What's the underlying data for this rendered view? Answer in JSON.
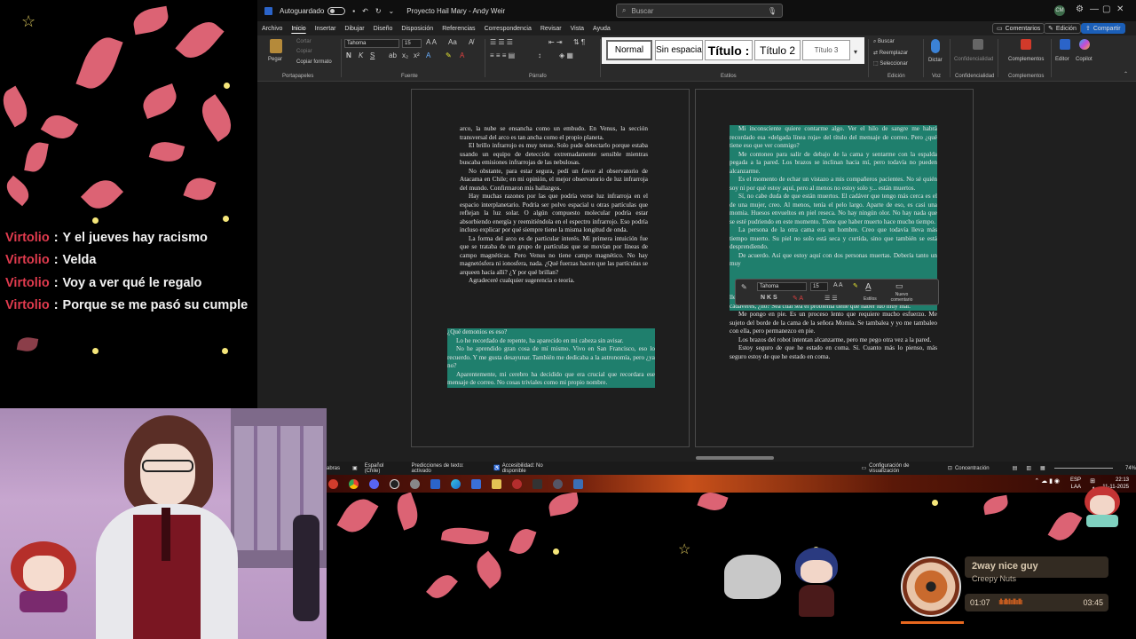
{
  "chat": {
    "messages": [
      {
        "user": "Virtolio",
        "text": "Y el jueves hay racismo"
      },
      {
        "user": "Virtolio",
        "text": "Velda"
      },
      {
        "user": "Virtolio",
        "text": "Voy a ver qué le regalo"
      },
      {
        "user": "Virtolio",
        "text": "Porque se me pasó su cumple"
      }
    ]
  },
  "word": {
    "autosave_label": "Autoguardado",
    "doc_title": "Proyecto Hail Mary - Andy Weir",
    "search_placeholder": "Buscar",
    "user_initials": "CM",
    "menu": [
      "Archivo",
      "Inicio",
      "Insertar",
      "Dibujar",
      "Diseño",
      "Disposición",
      "Referencias",
      "Correspondencia",
      "Revisar",
      "Vista",
      "Ayuda"
    ],
    "comments_label": "Comentarios",
    "edit_label": "Edición",
    "share_label": "Compartir",
    "ribbon": {
      "paste": "Pegar",
      "cut": "Cortar",
      "copy": "Copiar",
      "format_painter": "Copiar formato",
      "clipboard_group": "Portapapeles",
      "font_name": "Tahoma",
      "font_size": "15",
      "font_group": "Fuente",
      "paragraph_group": "Párrafo",
      "styles": [
        "Normal",
        "Sin espacia",
        "Título :",
        "Título 2",
        "Título 3"
      ],
      "styles_group": "Estilos",
      "find": "Buscar",
      "replace": "Reemplazar",
      "select": "Seleccionar",
      "editing_group": "Edición",
      "dictate": "Dictar",
      "voice_group": "Voz",
      "sensitivity": "Confidencialidad",
      "sensitivity_group": "Confidencialidad",
      "addins": "Complementos",
      "addins_group": "Complementos",
      "editor": "Editor",
      "copilot": "Copilot"
    },
    "page_left": {
      "paragraphs": [
        "arco, la nube se ensancha como un embudo. En Venus, la sección transversal del arco es tan ancha como el propio planeta.",
        "El brillo infrarrojo es muy tenue. Solo pude detectarlo porque estaba usando un equipo de detección extremadamente sensible mientras buscaba emisiones infrarrojas de las nebulosas.",
        "No obstante, para estar segura, pedí un favor al observatorio de Atacama en Chile; en mi opinión, el mejor observatorio de luz infrarroja del mundo. Confirmaron mis hallazgos.",
        "Hay muchas razones por las que podría verse luz infrarroja en el espacio interplanetario. Podría ser polvo espacial u otras partículas que reflejan la luz solar. O algún compuesto molecular podría estar absorbiendo energía y reemitiéndola en el espectro infrarrojo. Eso podría incluso explicar por qué siempre tiene la misma longitud de onda.",
        "La forma del arco es de particular interés. Mi primera intuición fue que se trataba de un grupo de partículas que se movían por líneas de campo magnéticas. Pero Venus no tiene campo magnético. No hay magnetósfera ni ionosfera, nada. ¿Qué fuerzas hacen que las partículas se arqueen hacia allí? ¿Y por qué brillan?",
        "Agradeceré cualquier sugerencia o teoría."
      ],
      "highlighted": [
        "¿Qué demonios es eso?",
        "Lo he recordado de repente, ha aparecido en mi cabeza sin avisar.",
        "No he aprendido gran cosa de mí mismo. Vivo en San Francisco, eso lo recuerdo. Y me gusta desayunar. También me dedicaba a la astronomía, pero ¿ya no?",
        "Aparentemente, mi cerebro ha decidido que era crucial que recordara ese mensaje de correo. No cosas triviales como mi propio nombre."
      ]
    },
    "page_right": {
      "highlighted": [
        "Mi inconsciente quiere contarme algo. Ver el hilo de sangre me habrá recordado esa «delgada línea roja» del título del mensaje de correo. Pero ¿qué tiene eso que ver conmigo?",
        "Me contoneo para salir de debajo de la cama y sentarme con la espalda pegada a la pared. Los brazos se inclinan hacia mí, pero todavía no pueden alcanzarme.",
        "Es el momento de echar un vistazo a mis compañeros pacientes. No sé quién soy ni por qué estoy aquí, pero al menos no estoy solo y... están muertos.",
        "Sí, no cabe duda de que están muertos. El cadáver que tengo más cerca es el de una mujer, creo. Al menos, tenía el pelo largo. Aparte de eso, es casi una momia. Huesos envueltos en piel reseca. No hay ningún olor. No hay nada que se esté pudriendo en este momento. Tiene que haber muerto hace mucho tiempo.",
        "La persona de la otra cama era un hombre. Creo que todavía lleva más tiempo muerto. Su piel no solo está seca y curtida, sino que también se está desprendiendo.",
        "De acuerdo. Así que estoy aquí con dos personas muertas. Debería tanto un muy",
        "Las personas muertas son una preocupación, pero me preocupa más que lleven tanto tiempo aquí. Incluso en una zona de cuarentena se retiran los cadáveres, ¿no? Sea cual sea el problema tiene que haber ido muy mal."
      ],
      "paragraphs": [
        "Me pongo en pie. Es un proceso lento que requiere mucho esfuerzo. Me sujeto del borde de la cama de la señora Momia. Se tambalea y yo me tambaleo con ella, pero permanezco en pie.",
        "Los brazos del robot intentan alcanzarme, pero me pego otra vez a la pared.",
        "Estoy seguro de que he estado en coma. Sí. Cuanto más lo pienso, más seguro estoy de que he estado en coma."
      ]
    },
    "float_toolbar": {
      "font": "Tahoma",
      "size": "15",
      "styles": "Estilos",
      "new_comment": "Nuevo comentario"
    },
    "status": {
      "words": "abras",
      "language": "Español (Chile)",
      "predictions": "Predicciones de texto: activado",
      "accessibility": "Accesibilidad: No disponible",
      "display_settings": "Configuración de visualización",
      "focus": "Concentración",
      "zoom": "74%"
    }
  },
  "taskbar": {
    "lang": "ESP",
    "region": "LAA",
    "time": "22:13",
    "date": "11-11-2025"
  },
  "now_playing": {
    "title": "2way nice guy",
    "artist": "Creepy Nuts",
    "elapsed": "01:07",
    "duration": "03:45",
    "progress_fraction": 0.3,
    "accent": "#e7681f"
  }
}
